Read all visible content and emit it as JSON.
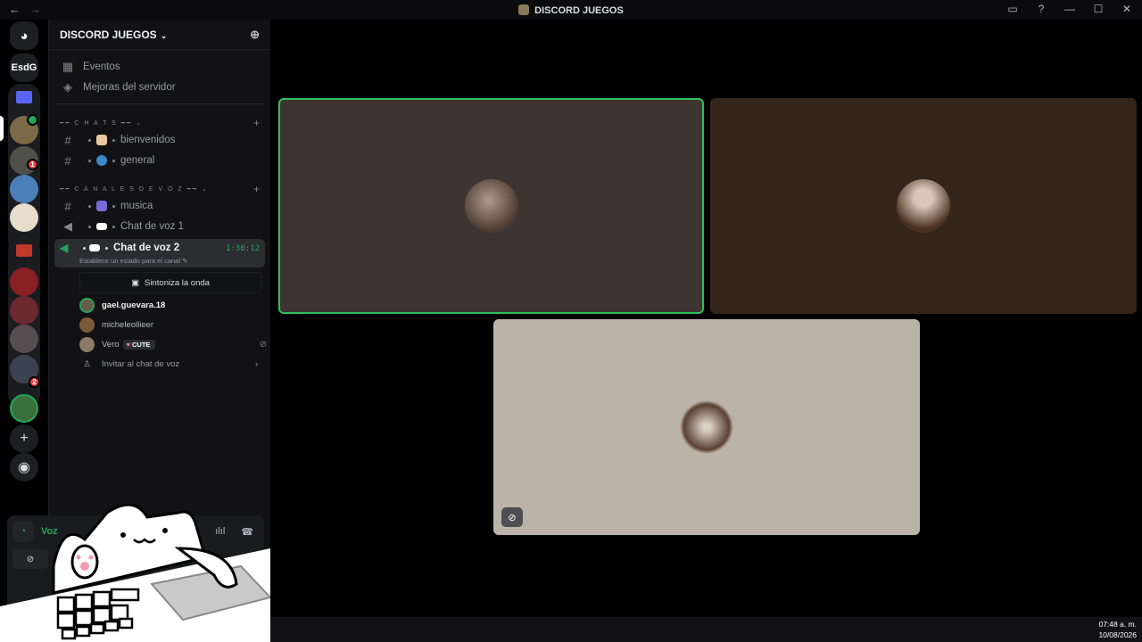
{
  "titlebar": {
    "back": "←",
    "forward": "→",
    "title": "DISCORD JUEGOS",
    "icons": [
      "inbox-icon",
      "help-icon",
      "minimize-icon",
      "maximize-icon",
      "close-icon"
    ],
    "inbox_glyph": "▭",
    "help_glyph": "?",
    "min_glyph": "—",
    "max_glyph": "☐",
    "close_glyph": "✕"
  },
  "guilds": {
    "dm_glyph": "◕",
    "text_server": "EsdG",
    "badges": [
      "1",
      "2"
    ],
    "add_glyph": "+",
    "discover_glyph": "◉"
  },
  "server": {
    "name": "DISCORD JUEGOS",
    "chev": "⌄",
    "add_user_glyph": "⊕",
    "eventos": "Eventos",
    "mejoras": "Mejoras del servidor"
  },
  "categories": {
    "chats": "━━ C H A T S ━━ ⌄",
    "voz": "━━ C A N A L E S D E V O Z ━━ ⌄",
    "plus": "+"
  },
  "text_channels": [
    {
      "name": "bienvenidos"
    },
    {
      "name": "general"
    }
  ],
  "voice_channels": [
    {
      "name": "musica"
    },
    {
      "name": "Chat de voz 1"
    }
  ],
  "active_channel": {
    "name": "Chat de voz 2",
    "time": "1:30:12",
    "status": "Establece un estado para el canal ✎"
  },
  "sintoniza": "Sintoniza la onda",
  "members": [
    {
      "name": "gael.guevara.18"
    },
    {
      "name": "micheleollieer"
    },
    {
      "name": "Vero",
      "tag": "CUTE",
      "tag_glyph": "♥"
    }
  ],
  "invite": "Invitar al chat de voz",
  "invite_arrow": "›",
  "voice_panel": {
    "label": "Voz",
    "signal_glyph": "◔",
    "wave_glyph": "ılıl",
    "hangup_glyph": "☎",
    "camera_glyph": "⊘"
  },
  "colors": {
    "speaking": "#2fbf5a",
    "tile1": "#3d3532",
    "tile2": "#33251a",
    "tile3": "#bbb3a8"
  },
  "tiles": [
    {
      "user": "gael.guevara.18"
    },
    {
      "user": "micheleollieer"
    },
    {
      "user": "Vero",
      "muted": true
    }
  ],
  "clock": {
    "time": "07:48 a. m.",
    "date": "10/08/2026"
  }
}
